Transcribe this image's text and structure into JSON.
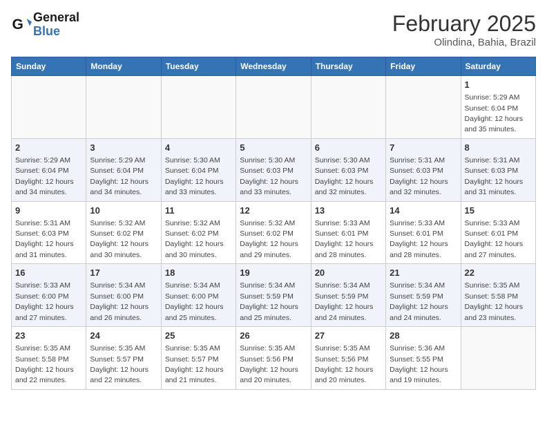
{
  "header": {
    "logo_line1": "General",
    "logo_line2": "Blue",
    "month": "February 2025",
    "location": "Olindina, Bahia, Brazil"
  },
  "weekdays": [
    "Sunday",
    "Monday",
    "Tuesday",
    "Wednesday",
    "Thursday",
    "Friday",
    "Saturday"
  ],
  "weeks": [
    [
      {
        "day": "",
        "info": ""
      },
      {
        "day": "",
        "info": ""
      },
      {
        "day": "",
        "info": ""
      },
      {
        "day": "",
        "info": ""
      },
      {
        "day": "",
        "info": ""
      },
      {
        "day": "",
        "info": ""
      },
      {
        "day": "1",
        "info": "Sunrise: 5:29 AM\nSunset: 6:04 PM\nDaylight: 12 hours\nand 35 minutes."
      }
    ],
    [
      {
        "day": "2",
        "info": "Sunrise: 5:29 AM\nSunset: 6:04 PM\nDaylight: 12 hours\nand 34 minutes."
      },
      {
        "day": "3",
        "info": "Sunrise: 5:29 AM\nSunset: 6:04 PM\nDaylight: 12 hours\nand 34 minutes."
      },
      {
        "day": "4",
        "info": "Sunrise: 5:30 AM\nSunset: 6:04 PM\nDaylight: 12 hours\nand 33 minutes."
      },
      {
        "day": "5",
        "info": "Sunrise: 5:30 AM\nSunset: 6:03 PM\nDaylight: 12 hours\nand 33 minutes."
      },
      {
        "day": "6",
        "info": "Sunrise: 5:30 AM\nSunset: 6:03 PM\nDaylight: 12 hours\nand 32 minutes."
      },
      {
        "day": "7",
        "info": "Sunrise: 5:31 AM\nSunset: 6:03 PM\nDaylight: 12 hours\nand 32 minutes."
      },
      {
        "day": "8",
        "info": "Sunrise: 5:31 AM\nSunset: 6:03 PM\nDaylight: 12 hours\nand 31 minutes."
      }
    ],
    [
      {
        "day": "9",
        "info": "Sunrise: 5:31 AM\nSunset: 6:03 PM\nDaylight: 12 hours\nand 31 minutes."
      },
      {
        "day": "10",
        "info": "Sunrise: 5:32 AM\nSunset: 6:02 PM\nDaylight: 12 hours\nand 30 minutes."
      },
      {
        "day": "11",
        "info": "Sunrise: 5:32 AM\nSunset: 6:02 PM\nDaylight: 12 hours\nand 30 minutes."
      },
      {
        "day": "12",
        "info": "Sunrise: 5:32 AM\nSunset: 6:02 PM\nDaylight: 12 hours\nand 29 minutes."
      },
      {
        "day": "13",
        "info": "Sunrise: 5:33 AM\nSunset: 6:01 PM\nDaylight: 12 hours\nand 28 minutes."
      },
      {
        "day": "14",
        "info": "Sunrise: 5:33 AM\nSunset: 6:01 PM\nDaylight: 12 hours\nand 28 minutes."
      },
      {
        "day": "15",
        "info": "Sunrise: 5:33 AM\nSunset: 6:01 PM\nDaylight: 12 hours\nand 27 minutes."
      }
    ],
    [
      {
        "day": "16",
        "info": "Sunrise: 5:33 AM\nSunset: 6:00 PM\nDaylight: 12 hours\nand 27 minutes."
      },
      {
        "day": "17",
        "info": "Sunrise: 5:34 AM\nSunset: 6:00 PM\nDaylight: 12 hours\nand 26 minutes."
      },
      {
        "day": "18",
        "info": "Sunrise: 5:34 AM\nSunset: 6:00 PM\nDaylight: 12 hours\nand 25 minutes."
      },
      {
        "day": "19",
        "info": "Sunrise: 5:34 AM\nSunset: 5:59 PM\nDaylight: 12 hours\nand 25 minutes."
      },
      {
        "day": "20",
        "info": "Sunrise: 5:34 AM\nSunset: 5:59 PM\nDaylight: 12 hours\nand 24 minutes."
      },
      {
        "day": "21",
        "info": "Sunrise: 5:34 AM\nSunset: 5:59 PM\nDaylight: 12 hours\nand 24 minutes."
      },
      {
        "day": "22",
        "info": "Sunrise: 5:35 AM\nSunset: 5:58 PM\nDaylight: 12 hours\nand 23 minutes."
      }
    ],
    [
      {
        "day": "23",
        "info": "Sunrise: 5:35 AM\nSunset: 5:58 PM\nDaylight: 12 hours\nand 22 minutes."
      },
      {
        "day": "24",
        "info": "Sunrise: 5:35 AM\nSunset: 5:57 PM\nDaylight: 12 hours\nand 22 minutes."
      },
      {
        "day": "25",
        "info": "Sunrise: 5:35 AM\nSunset: 5:57 PM\nDaylight: 12 hours\nand 21 minutes."
      },
      {
        "day": "26",
        "info": "Sunrise: 5:35 AM\nSunset: 5:56 PM\nDaylight: 12 hours\nand 20 minutes."
      },
      {
        "day": "27",
        "info": "Sunrise: 5:35 AM\nSunset: 5:56 PM\nDaylight: 12 hours\nand 20 minutes."
      },
      {
        "day": "28",
        "info": "Sunrise: 5:36 AM\nSunset: 5:55 PM\nDaylight: 12 hours\nand 19 minutes."
      },
      {
        "day": "",
        "info": ""
      }
    ]
  ]
}
